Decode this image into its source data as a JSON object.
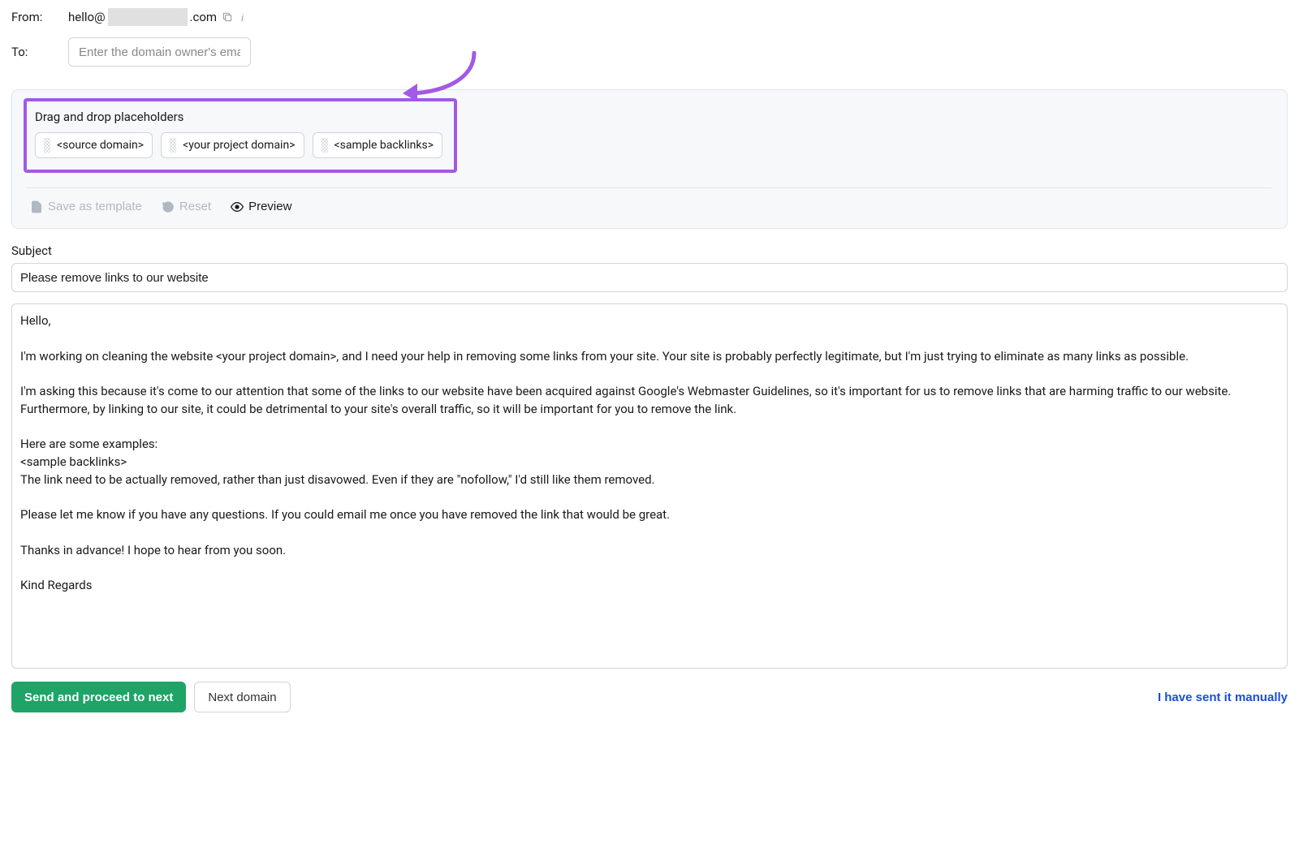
{
  "from": {
    "label": "From:",
    "prefix": "hello@",
    "suffix": ".com"
  },
  "to": {
    "label": "To:",
    "placeholder": "Enter the domain owner's email address"
  },
  "placeholders": {
    "title": "Drag and drop placeholders",
    "chips": [
      "<source domain>",
      "<your project domain>",
      "<sample backlinks>"
    ],
    "save_template": "Save as template",
    "reset": "Reset",
    "preview": "Preview"
  },
  "subject": {
    "label": "Subject",
    "value": "Please remove links to our website"
  },
  "body": {
    "value": "Hello,\n\nI'm working on cleaning the website <your project domain>, and I need your help in removing some links from your site. Your site is probably perfectly legitimate, but I'm just trying to eliminate as many links as possible.\n\nI'm asking this because it's come to our attention that some of the links to our website have been acquired against Google's Webmaster Guidelines, so it's important for us to remove links that are harming traffic to our website. Furthermore, by linking to our site, it could be detrimental to your site's overall traffic, so it will be important for you to remove the link.\n\nHere are some examples:\n<sample backlinks>\nThe link need to be actually removed, rather than just disavowed. Even if they are \"nofollow,\" I'd still like them removed.\n\nPlease let me know if you have any questions. If you could email me once you have removed the link that would be great.\n\nThanks in advance! I hope to hear from you soon.\n\nKind Regards"
  },
  "footer": {
    "send": "Send and proceed to next",
    "next_domain": "Next domain",
    "sent_manually": "I have sent it manually"
  },
  "colors": {
    "highlight": "#a259e6",
    "primary": "#1fa366",
    "link": "#1a4ed8"
  }
}
